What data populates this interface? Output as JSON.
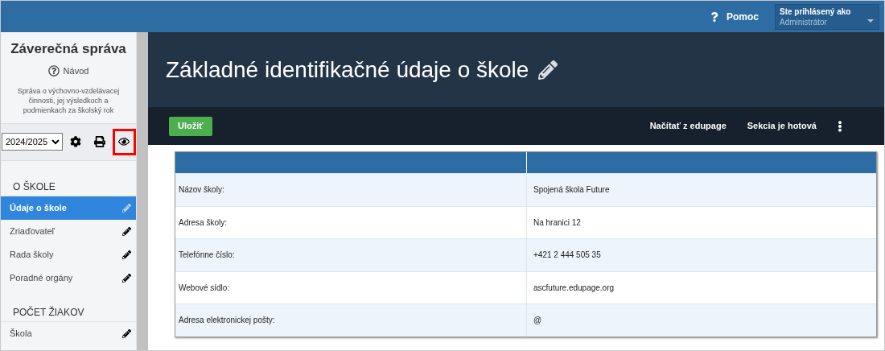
{
  "topbar": {
    "help": "Pomoc",
    "user_label": "Ste prihlásený ako",
    "user_value": "Administrátor"
  },
  "sidebar": {
    "title": "Záverečná správa",
    "guide": "Návod",
    "description": "Správa o výchovno-vzdelávacej činnosti, jej výsledkoch a podmienkach za školský rok",
    "year": "2024/2025",
    "tools": [
      {
        "kind": "settings",
        "highlighted": false
      },
      {
        "kind": "print",
        "highlighted": false
      },
      {
        "kind": "view",
        "highlighted": true
      }
    ],
    "sections": [
      {
        "heading": "O ŠKOLE",
        "items": [
          {
            "label": "Údaje o škole",
            "selected": true
          },
          {
            "label": "Zriaďovateľ",
            "selected": false
          },
          {
            "label": "Rada školy",
            "selected": false
          },
          {
            "label": "Poradné orgány",
            "selected": false
          }
        ]
      },
      {
        "heading": "POČET ŽIAKOV",
        "items": [
          {
            "label": "Škola",
            "selected": false
          }
        ]
      }
    ]
  },
  "page": {
    "title": "Základné identifikačné údaje o škole",
    "save": "Uložiť",
    "actions": [
      "Načítať z edupage",
      "Sekcia je hotová"
    ]
  },
  "table": {
    "rows": [
      {
        "label": "Názov školy:",
        "value": "Spojená škola Future"
      },
      {
        "label": "Adresa školy:",
        "value": "Na hranici 12"
      },
      {
        "label": "Telefónne číslo:",
        "value": "+421 2 444 505 35"
      },
      {
        "label": "Webové sídlo:",
        "value": "ascfuture.edupage.org"
      },
      {
        "label": "Adresa elektronickej pošty:",
        "value": "@"
      }
    ]
  }
}
